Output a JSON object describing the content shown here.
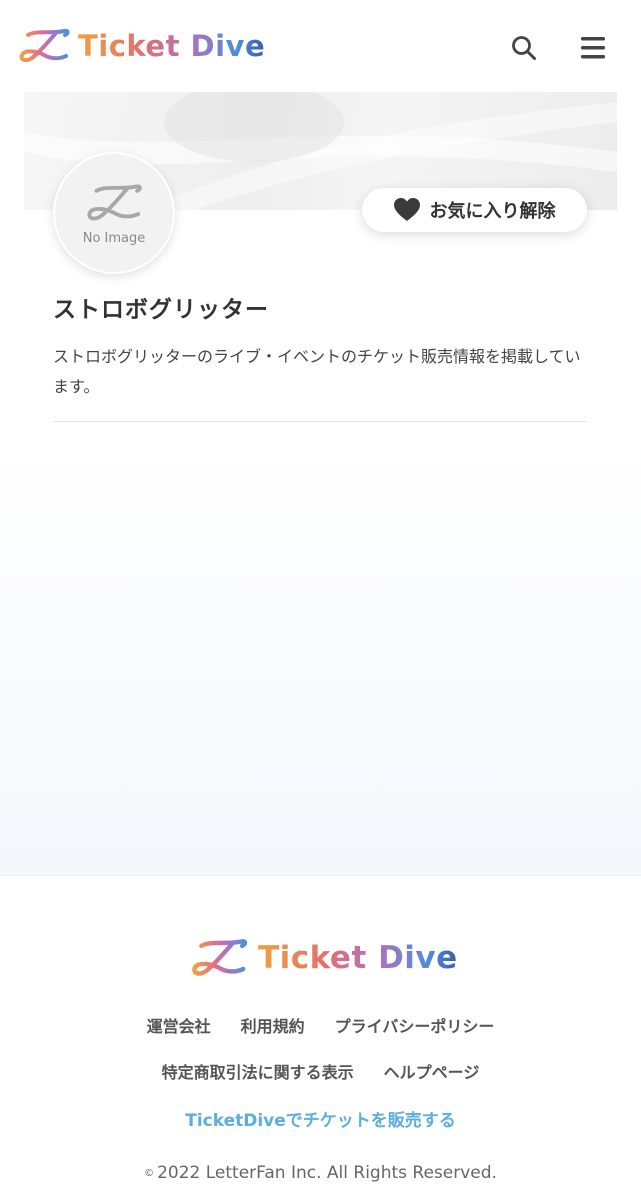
{
  "header": {
    "logo_text": "Ticket Dive",
    "search_icon": "search-icon",
    "menu_icon": "hamburger-menu-icon"
  },
  "artist": {
    "avatar_placeholder": "No Image",
    "favorite_button_label": "お気に入り解除",
    "favorite_icon": "heart-icon",
    "name": "ストロボグリッター",
    "description": "ストロボグリッターのライブ・イベントのチケット販売情報を掲載しています。"
  },
  "footer": {
    "logo_text": "Ticket Dive",
    "links_row1": [
      "運営会社",
      "利用規約",
      "プライバシーポリシー"
    ],
    "links_row2": [
      "特定商取引法に関する表示",
      "ヘルプページ"
    ],
    "sell_link": "TicketDiveでチケットを販売する",
    "copyright_mark": "©",
    "copyright": "2022 LetterFan Inc. All Rights Reserved."
  },
  "colors": {
    "accent_link": "#5aaee0",
    "text_dark": "#333333",
    "logo_gradient": [
      "#f0a040",
      "#e07070",
      "#b070c0",
      "#4f8fd8",
      "#3a5ab0"
    ]
  }
}
